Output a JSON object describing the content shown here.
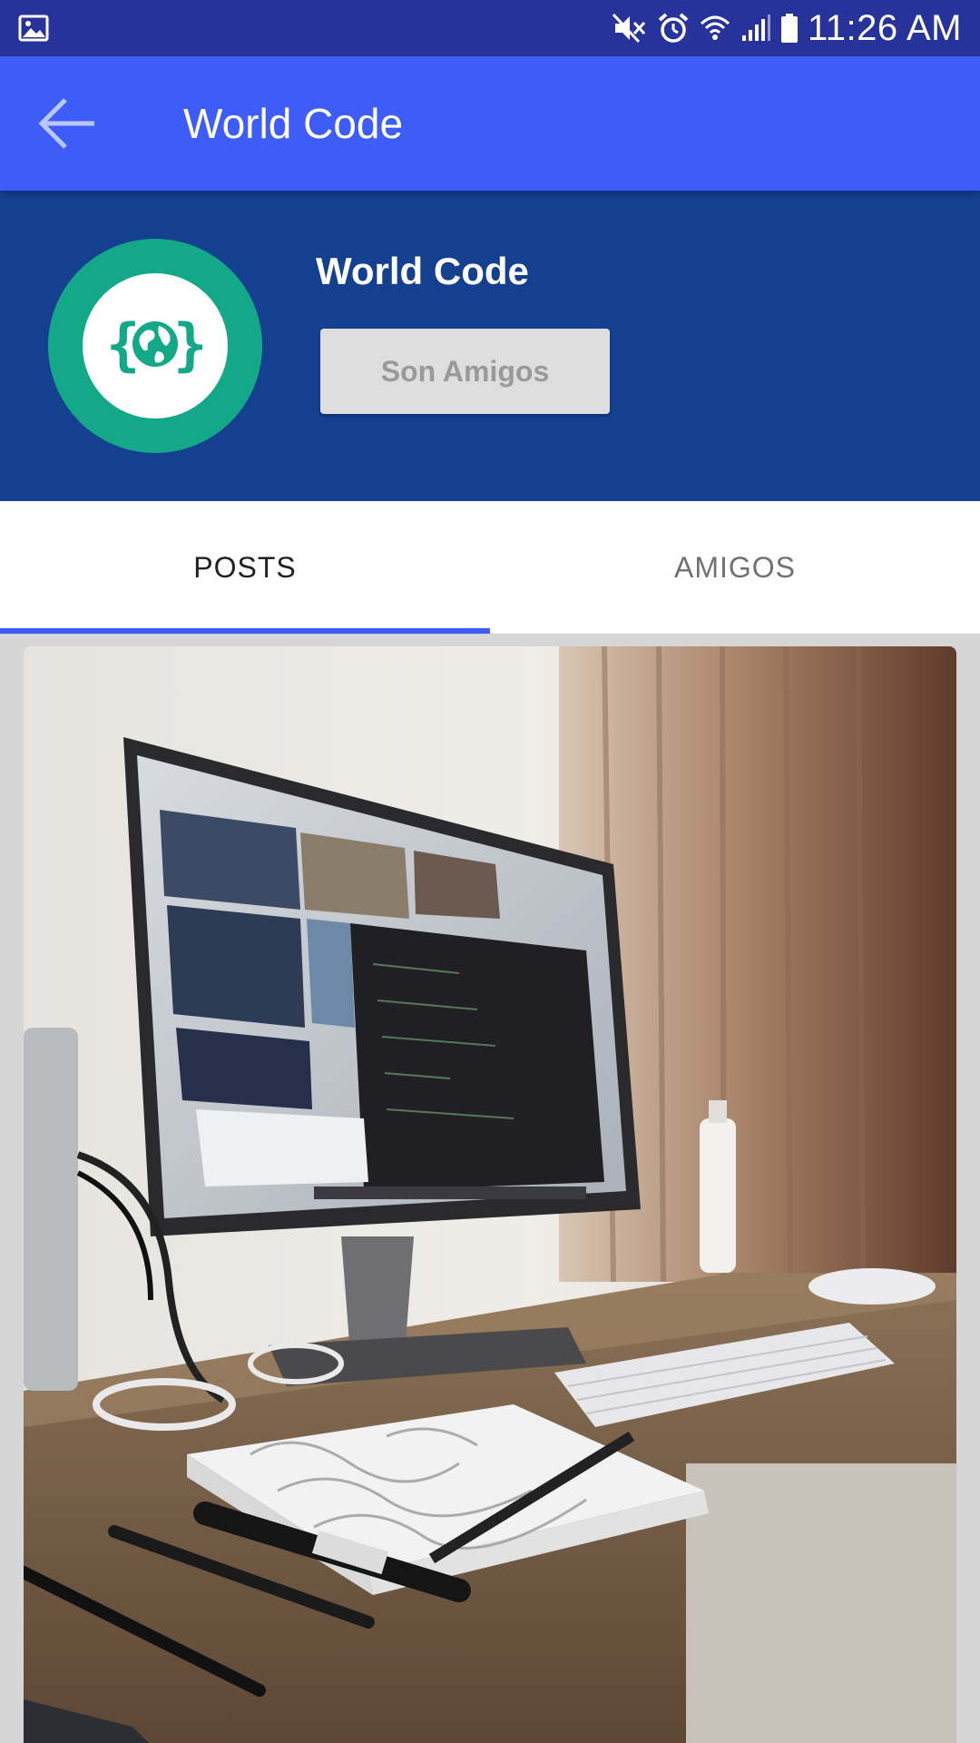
{
  "status_bar": {
    "time": "11:26 AM",
    "icons": [
      "image-icon",
      "mute-icon",
      "alarm-icon",
      "wifi-icon",
      "signal-icon",
      "battery-icon"
    ]
  },
  "app_bar": {
    "title": "World Code",
    "back_icon": "arrow-back-icon"
  },
  "profile": {
    "name": "World Code",
    "friend_button_label": "Son Amigos",
    "avatar_colors": {
      "ring": "#13a887",
      "inner": "#ffffff"
    }
  },
  "tabs": [
    {
      "label": "POSTS",
      "active": true
    },
    {
      "label": "AMIGOS",
      "active": false
    }
  ],
  "colors": {
    "status_bar": "#27339a",
    "app_bar": "#3e5cf7",
    "profile_header": "#14408f",
    "tab_indicator": "#3e5cf7"
  }
}
